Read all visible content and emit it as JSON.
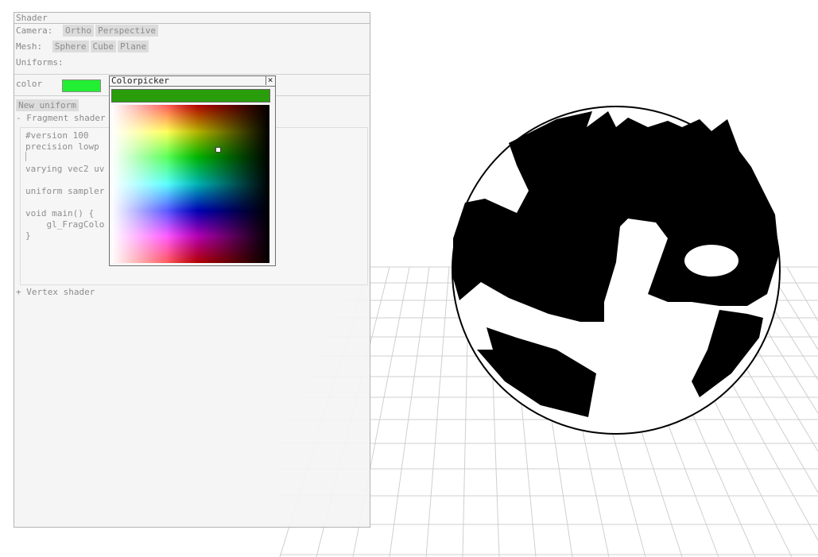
{
  "colors": {
    "uniform_swatch": "#22ee33",
    "picker_preview": "#2a9d0b",
    "panel_bg": "#f4f4f4",
    "mesh_fill": "#000000"
  },
  "panel": {
    "title": "Shader",
    "camera": {
      "label": "Camera:",
      "buttons": [
        "Ortho",
        "Perspective"
      ]
    },
    "mesh": {
      "label": "Mesh:",
      "buttons": [
        "Sphere",
        "Cube",
        "Plane"
      ]
    },
    "uniforms_label": "Uniforms:",
    "uniform": {
      "name": "color"
    },
    "new_uniform_button": "New uniform",
    "fragment_toggle": "- Fragment shader",
    "vertex_toggle": "+ Vertex shader",
    "code_lines": [
      "#version 100",
      "precision lowp",
      "",
      "varying vec2 uv",
      "",
      "uniform sampler",
      "",
      "void main() {",
      "    gl_FragColo",
      "}"
    ]
  },
  "colorpicker": {
    "title": "Colorpicker",
    "close_icon": "close-icon"
  },
  "viewport": {
    "grid": "perspective-floor-grid",
    "mesh": "sphere"
  }
}
